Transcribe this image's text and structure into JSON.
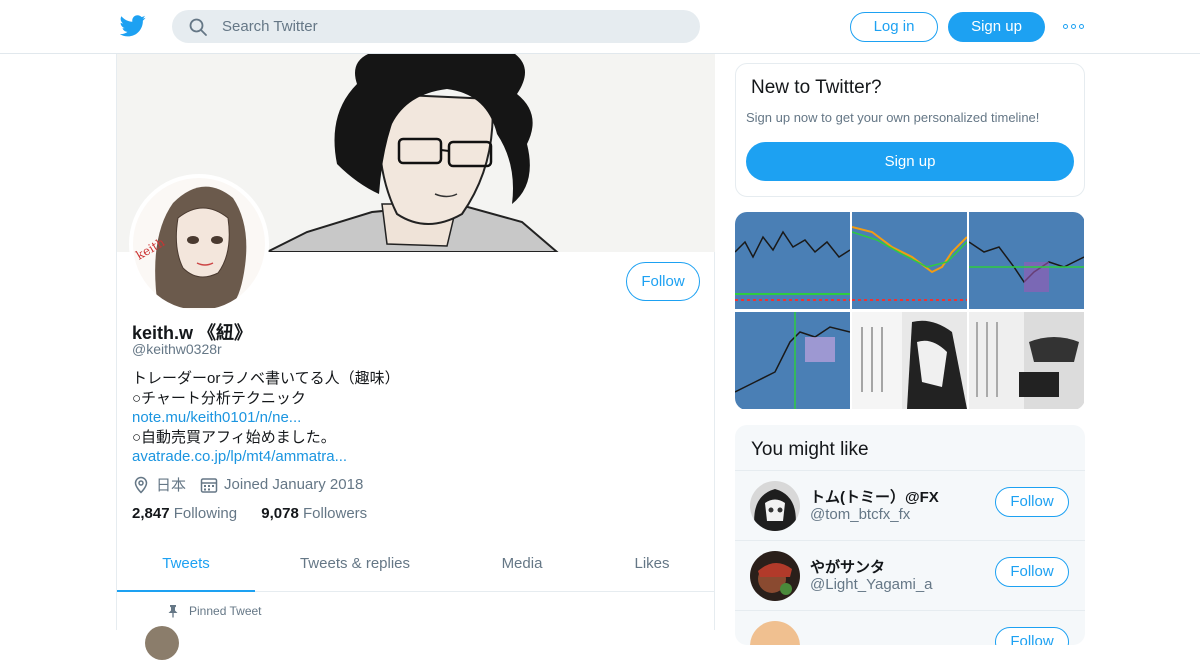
{
  "header": {
    "search_placeholder": "Search Twitter",
    "login_label": "Log in",
    "signup_label": "Sign up"
  },
  "profile": {
    "name": "keith.w 《紐》",
    "handle": "@keithw0328r",
    "follow_label": "Follow",
    "bio_lines": [
      "トレーダーorラノベ書いてる人（趣味）",
      "○チャート分析テクニック",
      "note.mu/keith0101/n/ne...",
      "○自動売買アフィ始めました。",
      "avatrade.co.jp/lp/mt4/ammatra..."
    ],
    "location": "日本",
    "joined": "Joined January 2018",
    "following_count": "2,847",
    "following_label": "Following",
    "followers_count": "9,078",
    "followers_label": "Followers",
    "tabs": [
      "Tweets",
      "Tweets & replies",
      "Media",
      "Likes"
    ],
    "active_tab": "Tweets",
    "pinned_label": "Pinned Tweet"
  },
  "new_to_twitter": {
    "title": "New to Twitter?",
    "subtitle": "Sign up now to get your own personalized timeline!",
    "button_label": "Sign up"
  },
  "you_might_like": {
    "title": "You might like",
    "follow_label": "Follow",
    "users": [
      {
        "name": "トム(トミー）@FX",
        "handle": "@tom_btcfx_fx"
      },
      {
        "name": "やがサンタ",
        "handle": "@Light_Yagami_a"
      }
    ]
  },
  "colors": {
    "accent": "#1da1f2",
    "link": "#1b95e0",
    "muted_text": "#657786",
    "border": "#e6ecf0"
  },
  "icons": [
    "twitter-bird-icon",
    "search-icon",
    "more-dots-icon",
    "location-pin-icon",
    "calendar-icon",
    "pin-icon"
  ]
}
